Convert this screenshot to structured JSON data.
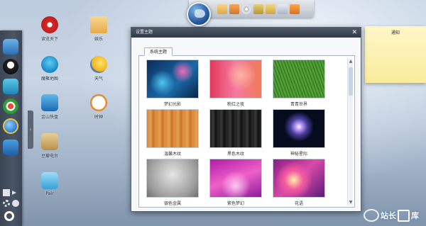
{
  "top_dock": {
    "icons": [
      "mail-icon",
      "folder-icon",
      "disc-icon",
      "media-icon",
      "photos-icon",
      "calendar-icon",
      "rss-icon"
    ],
    "colors": [
      "#f0b85a",
      "#e48a34",
      "#c9ccd2",
      "#d4b24a",
      "#e7c35d",
      "#c6cfdc",
      "#f08d2d"
    ]
  },
  "desktop_icons": [
    {
      "label": "读览天下",
      "icon": "reader-icon"
    },
    {
      "label": "魔聚地图",
      "icon": "map-icon"
    },
    {
      "label": "金山快盘",
      "icon": "cloud-drive-icon"
    },
    {
      "label": "豆瓣电台",
      "icon": "radio-icon"
    },
    {
      "label": "Pair",
      "icon": "pair-icon"
    },
    {
      "label": "娱乐",
      "icon": "folder-icon"
    },
    {
      "label": "天气",
      "icon": "weather-icon"
    },
    {
      "label": "时钟",
      "icon": "clock-icon"
    }
  ],
  "window": {
    "title": "设置主题",
    "close_glyph": "✕",
    "tab": "系统主题",
    "themes": [
      {
        "label": "梦幻光影"
      },
      {
        "label": "粉红之夜"
      },
      {
        "label": "青青世界"
      },
      {
        "label": "温馨木纹"
      },
      {
        "label": "黑色木纹"
      },
      {
        "label": "神秘星际"
      },
      {
        "label": "银色金属"
      },
      {
        "label": "紫色梦幻"
      },
      {
        "label": "花语"
      }
    ]
  },
  "sticky_note": {
    "title": "通知"
  },
  "left_dock": {
    "icons": [
      "app-store-icon",
      "qq-icon",
      "browser-icon",
      "security-icon",
      "ie-icon",
      "favorites-icon"
    ],
    "tray_icons": [
      "grid-icon",
      "volume-icon",
      "settings-icon",
      "theme-icon",
      "search-icon"
    ]
  },
  "watermark": {
    "text": "站长",
    "text2": "库"
  },
  "colors": {
    "accent": "#2f3845",
    "note": "#f9ec9c"
  }
}
